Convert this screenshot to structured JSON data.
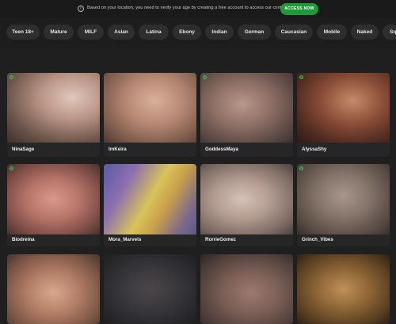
{
  "banner": {
    "info_icon": "i",
    "text": "Based on your location, you need to verify your age by creating a free account to access our content.",
    "access_button": "ACCESS NOW"
  },
  "tags": [
    "Teen 18+",
    "Mature",
    "MILF",
    "Asian",
    "Latina",
    "Ebony",
    "Indian",
    "German",
    "Caucasian",
    "Mobile",
    "Naked",
    "Sq"
  ],
  "colors": {
    "accent": "#1f9a3a",
    "live": "#33c24d",
    "background": "#1f1f1f",
    "card": "#262626"
  },
  "models": [
    {
      "name": "NinaSage",
      "live": true
    },
    {
      "name": "ImKeira",
      "live": true
    },
    {
      "name": "GoddessMaya",
      "live": true
    },
    {
      "name": "AlyssaShy",
      "live": true
    },
    {
      "name": "Biodreina",
      "live": true
    },
    {
      "name": "Mora_Marvels",
      "live": false
    },
    {
      "name": "RorrieGomez",
      "live": false
    },
    {
      "name": "Grinch_Vibes",
      "live": true
    },
    {
      "name": "",
      "live": false
    },
    {
      "name": "",
      "live": false
    },
    {
      "name": "",
      "live": false
    },
    {
      "name": "",
      "live": false
    }
  ]
}
